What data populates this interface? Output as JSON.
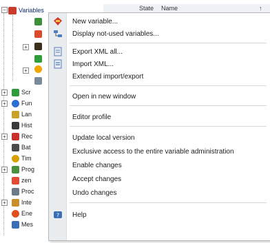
{
  "tree": {
    "root_label": "Variables",
    "nodes": [
      "Scr",
      "Fun",
      "Lan",
      "Hist",
      "Rec",
      "Bat",
      "Tim",
      "Prog",
      "zen",
      "Proc",
      "Inte",
      "Ene",
      "Mes"
    ]
  },
  "header": {
    "col_state": "State",
    "col_name": "Name"
  },
  "menu": {
    "items": [
      {
        "label": "New variable...",
        "icon": "new-variable-icon"
      },
      {
        "label": "Display not-used variables...",
        "icon": "display-unused-icon"
      },
      {
        "label": "Export XML all...",
        "icon": "export-xml-icon"
      },
      {
        "label": "Import XML...",
        "icon": "import-xml-icon"
      },
      {
        "label": "Extended import/export",
        "icon": ""
      },
      {
        "label": "Open in new window",
        "icon": ""
      },
      {
        "label": "Editor profile",
        "icon": ""
      },
      {
        "label": "Update local version",
        "icon": ""
      },
      {
        "label": "Exclusive access to the entire variable administration",
        "icon": ""
      },
      {
        "label": "Enable changes",
        "icon": ""
      },
      {
        "label": "Accept changes",
        "icon": ""
      },
      {
        "label": "Undo changes",
        "icon": ""
      },
      {
        "label": "Help",
        "icon": "help-icon"
      }
    ]
  },
  "colors": {
    "accent": "#0b2a6b",
    "gutter": "#eaedf0"
  }
}
